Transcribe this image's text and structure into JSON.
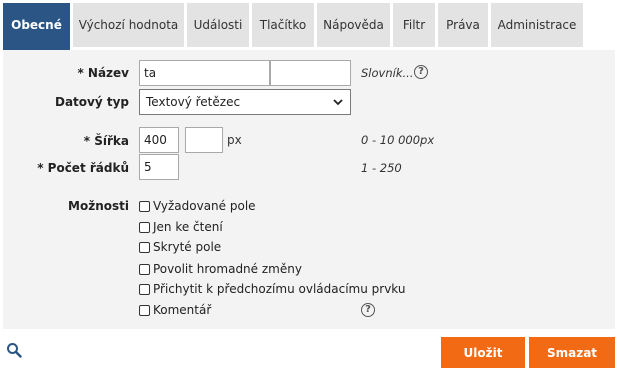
{
  "tabs": [
    {
      "label": "Obecné",
      "active": true
    },
    {
      "label": "Výchozí hodnota"
    },
    {
      "label": "Události"
    },
    {
      "label": "Tlačítko"
    },
    {
      "label": "Nápověda"
    },
    {
      "label": "Filtr"
    },
    {
      "label": "Práva"
    },
    {
      "label": "Administrace"
    }
  ],
  "form": {
    "name_label": "* Název",
    "name_value": "ta",
    "name_extra_value": "",
    "dictionary_link": "Slovník...",
    "type_label": "Datový typ",
    "type_value": "Textový řetězec",
    "width_label": "* Šířka",
    "width_value": "400",
    "width_extra_value": "",
    "width_unit": "px",
    "width_hint": "0 - 10 000px",
    "rows_label": "* Počet řádků",
    "rows_value": "5",
    "rows_hint": "1 - 250",
    "options_label": "Možnosti",
    "options": [
      {
        "label": "Vyžadované pole",
        "checked": false
      },
      {
        "label": "Jen ke čtení",
        "checked": false
      },
      {
        "label": "Skryté pole",
        "checked": false
      },
      {
        "label": "Povolit hromadné změny",
        "checked": false
      },
      {
        "label": "Přichytit k předchozímu ovládacímu prvku",
        "checked": false
      },
      {
        "label": "Komentář",
        "checked": false
      }
    ]
  },
  "footer": {
    "save_label": "Uložit",
    "delete_label": "Smazat"
  },
  "colors": {
    "active_tab": "#2b5585",
    "button": "#f26a13",
    "panel": "#f3f3f3"
  },
  "icons": {
    "search": "magnifier-icon",
    "help": "question-circle-icon",
    "dropdown": "chevron-down-icon"
  }
}
